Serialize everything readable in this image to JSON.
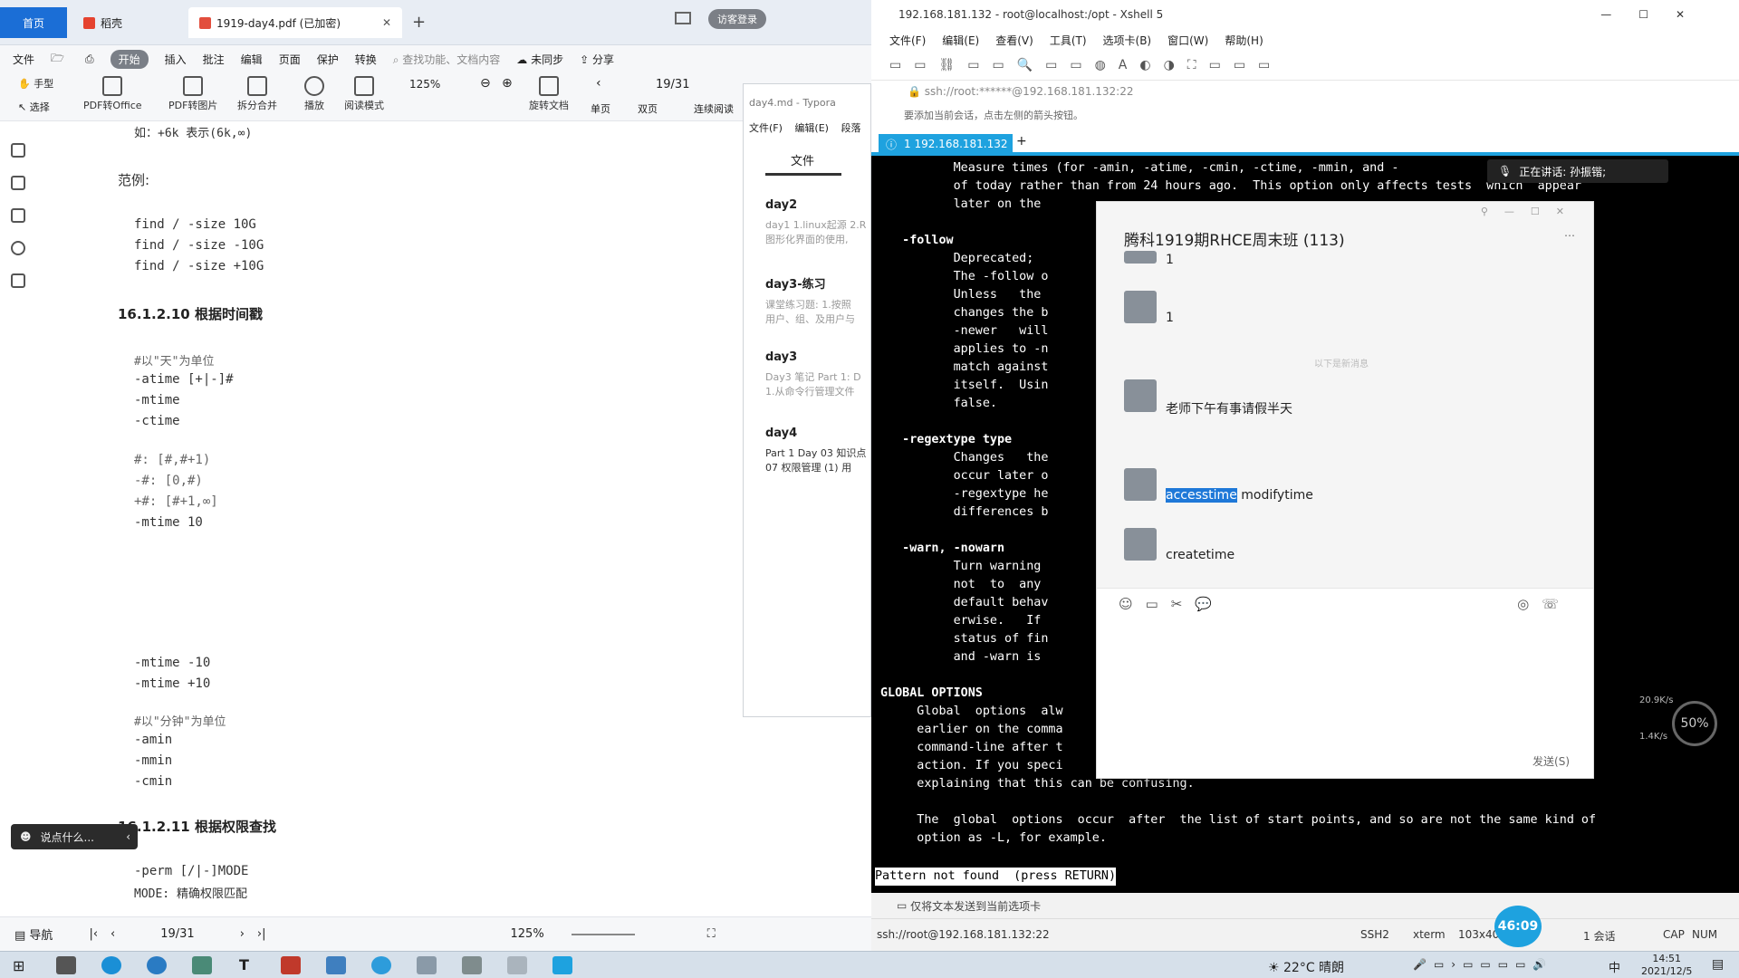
{
  "wps": {
    "tab_home": "首页",
    "tab_daoke": "稻壳",
    "tab_pdf": "1919-day4.pdf (已加密)",
    "login": "访客登录",
    "menu": [
      "文件",
      "开始",
      "插入",
      "批注",
      "编辑",
      "页面",
      "保护",
      "转换"
    ],
    "search": "查找功能、文档内容",
    "sync": "未同步",
    "share": "分享",
    "tools": [
      "手型",
      "选择",
      "PDF转Office",
      "PDF转图片",
      "拆分合并",
      "播放",
      "阅读模式",
      "125%",
      "19/31",
      "旋转文档",
      "单页",
      "双页",
      "连续阅读"
    ],
    "pdf": {
      "line_top": "如：+6k 表示(6k,∞)",
      "example_label": "范例:",
      "find_lines": [
        "find / -size 10G",
        "find / -size -10G",
        "find / -size +10G"
      ],
      "h_time": "16.1.2.10 根据时间戳",
      "day_comment": "#以\"天\"为单位",
      "atime": "-atime [+|-]#",
      "mtime": "-mtime",
      "ctime": "-ctime",
      "range1": "#: [#,#+1)",
      "range2": "-#: [0,#)",
      "range3": "+#: [#+1,∞]",
      "mtime10": "-mtime 10",
      "mtime_minus": "-mtime -10",
      "mtime_plus": "-mtime +10",
      "min_comment": "#以\"分钟\"为单位",
      "amin": "-amin",
      "mmin": "-mmin",
      "cmin": "-cmin",
      "h_perm": "16.1.2.11 根据权限查找",
      "perm": "-perm [/|-]MODE",
      "mode": "MODE: 精确权限匹配"
    },
    "chat_prompt": "说点什么...",
    "status": {
      "nav": "导航",
      "page": "19/31",
      "zoom": "125%"
    }
  },
  "typora": {
    "title": "day4.md - Typora",
    "menu": [
      "文件(F)",
      "编辑(E)",
      "段落"
    ],
    "tab": "文件",
    "files": [
      {
        "name": "day2",
        "desc1": "day1 1.linux起源 2.R",
        "desc2": "图形化界面的使用,"
      },
      {
        "name": "day3-练习",
        "desc1": "课堂练习题: 1.按照",
        "desc2": "用户、组、及用户与"
      },
      {
        "name": "day3",
        "desc1": "Day3 笔记 Part 1: D",
        "desc2": "1.从命令行管理文件"
      },
      {
        "name": "day4",
        "desc1": "Part 1 Day 03 知识点",
        "desc2": "07 权限管理 (1) 用"
      }
    ]
  },
  "xshell": {
    "title": "192.168.181.132 - root@localhost:/opt - Xshell 5",
    "menu": [
      "文件(F)",
      "编辑(E)",
      "查看(V)",
      "工具(T)",
      "选项卡(B)",
      "窗口(W)",
      "帮助(H)"
    ],
    "address": "ssh://root:******@192.168.181.132:22",
    "hint": "要添加当前会话，点击左侧的箭头按钮。",
    "tab": "1 192.168.181.132",
    "speaking": "正在讲话: 孙振锴;",
    "terminal": [
      "          Measure times (for -amin, -atime, -cmin, -ctime, -mmin, and -",
      "          of today rather than from 24 hours ago.  This option only affects tests  which  appear",
      "          later on the",
      "",
      "   -follow",
      "          Deprecated;                                                      ies -noleaf.",
      "          The -follow o                                                    ommand line.",
      "          Unless   the                                                     ollow option",
      "          changes the b                                                    argument  of",
      "          -newer   will                                                    onsideration",
      "          applies to -n                                                    will  always",
      "          match against                                                    han the link",
      "          itself.  Usin                                                     to  return",
      "          false.",
      "",
      "   -regextype type",
      "          Changes   the                                                    tests which",
      "          occur later o                                                    e known, use",
      "          -regextype he                                                    aning of and",
      "          differences b",
      "",
      "   -warn, -nowarn",
      "          Turn warning                                                     line usage,",
      "          not  to  any                                                     tories.  The",
      "          default behav                                                    -nowarn oth-",
      "          erwise.   If                                                     ed, the exit",
      "          status of fin                                                    le  is  set,",
      "          and -warn is                                                     e active.",
      "",
      "GLOBAL OPTIONS",
      "     Global  options  alw",
      "     earlier on the comma",
      "     command-line after t                                                 al option or",
      "     action. If you speci                                                 ning message",
      "     explaining that this can be confusing.",
      "",
      "     The  global  options  occur  after  the list of start points, and so are not the same kind of",
      "     option as -L, for example.",
      "",
      "Pattern not found  (press RETURN)"
    ],
    "send_bar": "仅将文本发送到当前选项卡",
    "status_left": "ssh://root@192.168.181.132:22",
    "status_items": [
      "SSH2",
      "xterm",
      "103x40",
      "1 会话",
      "CAP",
      "NUM"
    ],
    "timer": "46:09",
    "meter_pct": "50%",
    "net_up": "20.9K/s",
    "net_down": "1.4K/s"
  },
  "qq": {
    "title": "腾科1919期RHCE周末班 (113)",
    "messages": [
      {
        "name": "",
        "text": "1"
      },
      {
        "name": "",
        "text": "1"
      },
      {
        "name": "",
        "text": "老师下午有事请假半天"
      },
      {
        "name": "",
        "text_hl": "accesstime",
        "text": "modifytime"
      },
      {
        "name": "",
        "text": "createtime"
      }
    ],
    "divider": "以下是新消息",
    "send": "发送(S)"
  },
  "taskbar": {
    "weather": "22°C 晴朗",
    "ime": "中",
    "time": "14:51",
    "date": "2021/12/5"
  }
}
